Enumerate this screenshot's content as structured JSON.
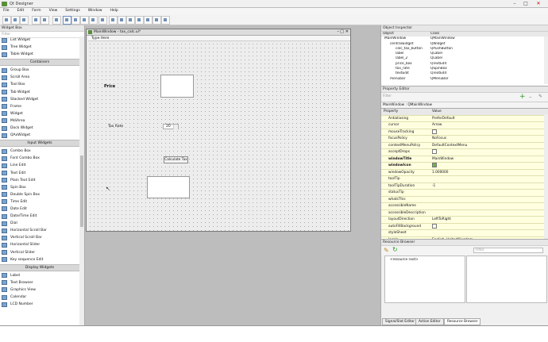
{
  "window": {
    "title": "Qt Designer"
  },
  "menubar": [
    "File",
    "Edit",
    "Form",
    "View",
    "Settings",
    "Window",
    "Help"
  ],
  "widget_box": {
    "title": "Widget Box",
    "filter_placeholder": "Filter",
    "groups": [
      {
        "name": null,
        "items": [
          "List Widget",
          "Tree Widget",
          "Table Widget"
        ]
      },
      {
        "name": "Containers",
        "items": [
          "Group Box",
          "Scroll Area",
          "Tool Box",
          "Tab Widget",
          "Stacked Widget",
          "Frame",
          "Widget",
          "MdiArea",
          "Dock Widget",
          "QAxWidget"
        ]
      },
      {
        "name": "Input Widgets",
        "items": [
          "Combo Box",
          "Font Combo Box",
          "Line Edit",
          "Text Edit",
          "Plain Text Edit",
          "Spin Box",
          "Double Spin Box",
          "Time Edit",
          "Date Edit",
          "Date/Time Edit",
          "Dial",
          "Horizontal Scroll Bar",
          "Vertical Scroll Bar",
          "Horizontal Slider",
          "Vertical Slider",
          "Key sequence Edit"
        ]
      },
      {
        "name": "Display Widgets",
        "items": [
          "Label",
          "Text Browser",
          "Graphics View",
          "Calendar",
          "LCD Number"
        ]
      }
    ]
  },
  "form": {
    "title": "MainWindow - tax_calc.ui*",
    "menu_placeholder": "Type Here",
    "price_label": "Price",
    "tax_rate_label": "Tax Rate",
    "tax_rate_value": "20",
    "calc_button": "Calculate Tax"
  },
  "object_inspector": {
    "title": "Object Inspector",
    "headers": [
      "Object",
      "Class"
    ],
    "rows": [
      {
        "obj": "MainWindow",
        "cls": "QMainWindow",
        "level": 0
      },
      {
        "obj": "centralwidget",
        "cls": "QWidget",
        "level": 1
      },
      {
        "obj": "calc_tax_button",
        "cls": "QPushButton",
        "level": 2
      },
      {
        "obj": "label",
        "cls": "QLabel",
        "level": 2
      },
      {
        "obj": "label_2",
        "cls": "QLabel",
        "level": 2
      },
      {
        "obj": "price_box",
        "cls": "QTextEdit",
        "level": 2
      },
      {
        "obj": "tax_rate",
        "cls": "QSpinBox",
        "level": 2
      },
      {
        "obj": "textEdit",
        "cls": "QTextEdit",
        "level": 2
      },
      {
        "obj": "menubar",
        "cls": "QMenuBar",
        "level": 1
      }
    ]
  },
  "property_editor": {
    "title": "Property Editor",
    "filter_placeholder": "Filter",
    "context": "MainWindow : QMainWindow",
    "headers": [
      "Property",
      "Value"
    ],
    "rows": [
      {
        "p": "Antialiasing",
        "v": "PreferDefault"
      },
      {
        "p": "cursor",
        "v": "Arrow"
      },
      {
        "p": "mouseTracking",
        "v": "",
        "check": false
      },
      {
        "p": "focusPolicy",
        "v": "NoFocus"
      },
      {
        "p": "contextMenuPolicy",
        "v": "DefaultContextMenu"
      },
      {
        "p": "acceptDrops",
        "v": "",
        "check": false
      },
      {
        "p": "windowTitle",
        "v": "MainWindow"
      },
      {
        "p": "windowIcon",
        "v": "",
        "check": true
      },
      {
        "p": "windowOpacity",
        "v": "1.000000"
      },
      {
        "p": "toolTip",
        "v": ""
      },
      {
        "p": "toolTipDuration",
        "v": "-1"
      },
      {
        "p": "statusTip",
        "v": ""
      },
      {
        "p": "whatsThis",
        "v": ""
      },
      {
        "p": "accessibleName",
        "v": ""
      },
      {
        "p": "accessibleDescription",
        "v": ""
      },
      {
        "p": "layoutDirection",
        "v": "LeftToRight"
      },
      {
        "p": "autoFillBackground",
        "v": "",
        "check": false
      },
      {
        "p": "styleSheet",
        "v": ""
      },
      {
        "p": "locale",
        "v": "English, UnitedKingdom"
      },
      {
        "p": "windowFilePath",
        "v": ""
      }
    ]
  },
  "resource_browser": {
    "title": "Resource Browser",
    "filter_placeholder": "Filter",
    "root": "<resource root>"
  },
  "bottom_tabs": [
    "Signal/Slot Editor",
    "Action Editor",
    "Resource Browser"
  ]
}
